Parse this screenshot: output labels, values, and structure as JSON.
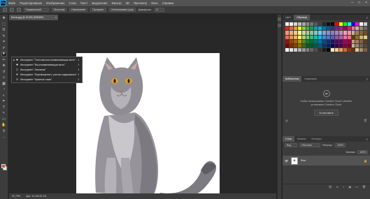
{
  "menubar": {
    "logo": "Ps",
    "items": [
      "Файл",
      "Редактирование",
      "Изображение",
      "Слои",
      "Текст",
      "Выделение",
      "Фильтр",
      "3D",
      "Просмотр",
      "Окно",
      "Справка"
    ],
    "controls": [
      "–",
      "□",
      "×"
    ]
  },
  "options": {
    "mode_select": "Нормальный",
    "btn_source": "Источник",
    "btn_dest": "Назначение",
    "btn_transparent": "Прозрачн.",
    "btn_use_pattern": "Использовать узор",
    "diffusion_label": "Диффузия:",
    "diffusion_value": "5"
  },
  "toolbar": {
    "tools": [
      "move-tool-icon",
      "marquee-tool-icon",
      "lasso-tool-icon",
      "quick-select-tool-icon",
      "crop-tool-icon",
      "eyedropper-tool-icon",
      "healing-brush-tool-icon",
      "brush-tool-icon",
      "clone-stamp-tool-icon",
      "history-brush-tool-icon",
      "eraser-tool-icon",
      "gradient-tool-icon",
      "blur-tool-icon",
      "dodge-tool-icon",
      "pen-tool-icon",
      "type-tool-icon",
      "path-select-tool-icon",
      "shape-tool-icon",
      "hand-tool-icon",
      "zoom-tool-icon",
      "more-tools-icon"
    ],
    "glyphs": [
      "✥",
      "⬚",
      "ʘ",
      "✎",
      "⌗",
      "✐",
      "✚",
      "✏",
      "⊕",
      "↺",
      "◇",
      "▦",
      "◔",
      "◐",
      "✒",
      "T",
      "↖",
      "▭",
      "✋",
      "⚲",
      "…"
    ],
    "fg_color": "#d06018",
    "bg_color": "#f0f0f0"
  },
  "document": {
    "tab_title": "Котик.jpg @ 32,8% (RGB/8*)",
    "tab_close": "×",
    "zoom": "32,79%",
    "doc_info": "Док: 10,1M/10,1M"
  },
  "flyout": {
    "items": [
      {
        "label": "Инструмент \"Точечная восстанавливающая кисть\"",
        "key": "J",
        "icon": "spot-healing-icon",
        "glyph": "✚",
        "active": true
      },
      {
        "label": "Инструмент \"Восстанавливающая кисть\"",
        "key": "J",
        "icon": "healing-brush-icon",
        "glyph": "✚",
        "active": false
      },
      {
        "label": "Инструмент \"Заплатка\"",
        "key": "J",
        "icon": "patch-icon",
        "glyph": "⬡",
        "active": false
      },
      {
        "label": "Инструмент \"Перемещение с учетом содержимого\"",
        "key": "J",
        "icon": "content-aware-move-icon",
        "glyph": "✣",
        "active": false
      },
      {
        "label": "Инструмент \"Красные глаза\"",
        "key": "J",
        "icon": "red-eye-icon",
        "glyph": "⊙",
        "active": false
      }
    ],
    "active_mark": "■"
  },
  "panels": {
    "top_tabs": [
      "Цвет",
      "Образцы"
    ],
    "menu_glyph": "≡",
    "swatch_colors": [
      [
        "#ffffff",
        "#f2f2f2",
        "#d9d9d9",
        "#bfbfbf",
        "#a6a6a6",
        "#8c8c8c",
        "#737373",
        "#595959",
        "#404040",
        "#262626",
        "#0d0d0d",
        "#000000",
        "#ff0000",
        "#ffff00",
        "#00ff00",
        "#00ffff",
        "#0000ff",
        "#ff00ff",
        "#ffffff",
        "#cccccc"
      ],
      [
        "#ed1c24",
        "#f26522",
        "#f7941d",
        "#fff200",
        "#8dc63f",
        "#39b54a",
        "#00a651",
        "#00a99d",
        "#00aeef",
        "#0072bc",
        "#0054a6",
        "#2e3192",
        "#662d91",
        "#92278f",
        "#9e005d",
        "#ed145b",
        "#f06eaa",
        "#c2b59b",
        "#998675",
        "#736357"
      ],
      [
        "#f69679",
        "#f9ad81",
        "#fdc689",
        "#fff799",
        "#c4df9b",
        "#a3d39c",
        "#82ca9c",
        "#7accc8",
        "#6dcff6",
        "#7da7d9",
        "#8393ca",
        "#8781bd",
        "#a186be",
        "#bd8cbf",
        "#f49ac1",
        "#f5989d",
        "#c7b299",
        "#a67c52",
        "#8c6239",
        "#754c24"
      ],
      [
        "#f26c4f",
        "#f68e56",
        "#fbaf5d",
        "#fff568",
        "#acd372",
        "#7cc576",
        "#3bb878",
        "#1abbb4",
        "#00bff3",
        "#448ccb",
        "#5674b9",
        "#605ca8",
        "#8560a8",
        "#a864a8",
        "#f06ea9",
        "#f26d7d",
        "#603913",
        "#8a6d3b",
        "#d1b37a",
        "#e6c98f"
      ],
      [
        "#9e0b0f",
        "#a0410d",
        "#a36209",
        "#aba000",
        "#598527",
        "#1a7b30",
        "#007236",
        "#00746b",
        "#0076a3",
        "#004b80",
        "#003471",
        "#1b1464",
        "#440e62",
        "#630460",
        "#9e005d",
        "#9e0039",
        "#c69c6d",
        "#a67c52",
        "#8b5e3c",
        "#5c3d1e"
      ],
      [
        "#790000",
        "#7b2e00",
        "#7d4900",
        "#827b00",
        "#406618",
        "#005e20",
        "#005826",
        "#005952",
        "#005b7f",
        "#003663",
        "#002157",
        "#0d004c",
        "#32004b",
        "#4b0049",
        "#7b0046",
        "#7a0026",
        "#c2b59b",
        "#998675",
        "#736357",
        "#534741"
      ],
      [
        "#ffffff",
        "#e6e6e6",
        "#cccccc",
        "#b3b3b3",
        "#999999",
        "#808080",
        "#666666",
        "#4d4d4d",
        "#333333",
        "#1a1a1a",
        "#000000",
        "#ffe6cc",
        "#ffcc99",
        "#ff9966",
        "#cc6633",
        "#993300",
        "#663300",
        "#e5c7a2",
        "#b3926b",
        "#806040"
      ]
    ],
    "lib_tabs": [
      "Библиотеки",
      "Коррекция"
    ],
    "lib_icon": "☁",
    "lib_text": "Чтобы использовать Creative Cloud Libraries, установите Creative Cloud",
    "lib_button": "Установить",
    "lib_foot_left": "▤",
    "lib_foot_right": "🗑",
    "layer_tabs": [
      "Слои",
      "Каналы",
      "Контуры"
    ],
    "layer_kind": "Вид",
    "layer_mode": "Обычные",
    "layer_opacity_label": "Непрозр.:",
    "layer_opacity": "100%",
    "layer_fill_label": "Заливка:",
    "layer_fill": "100%",
    "layer_name": "Фон",
    "layer_visible_glyph": "👁",
    "layer_lock_glyph": "🔒",
    "layer_thumb_glyph": "▲",
    "layer_foot_glyphs": [
      "⛓",
      "fx",
      "◐",
      "▣",
      "▭",
      "🗑"
    ]
  }
}
